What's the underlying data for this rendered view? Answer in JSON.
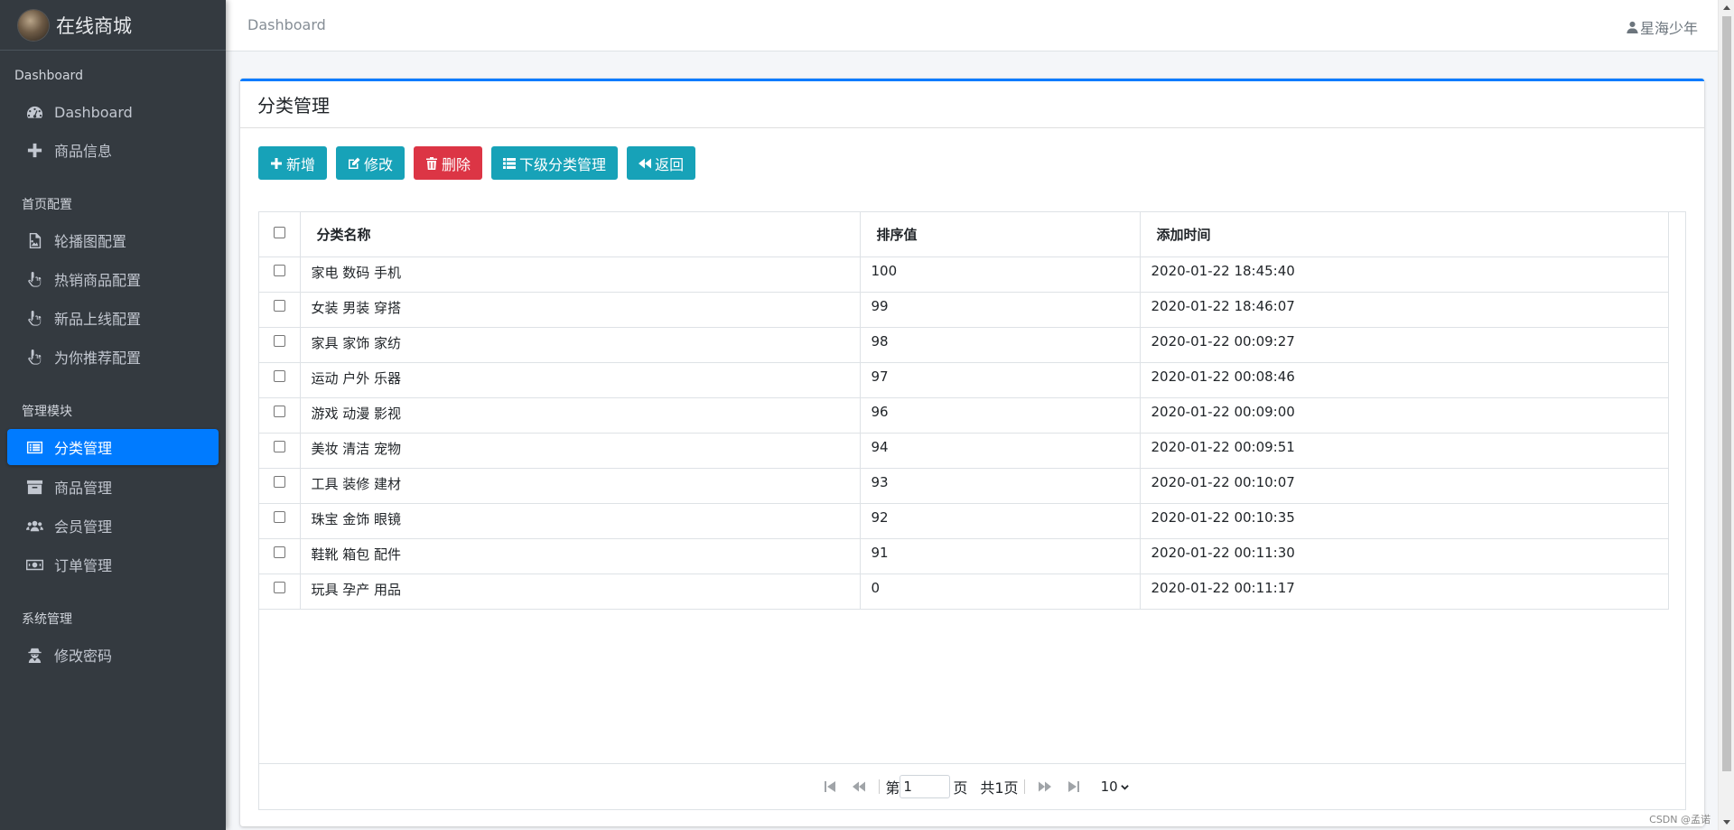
{
  "brand": {
    "name": "在线商城"
  },
  "sidebar": {
    "sections": [
      {
        "header": "Dashboard",
        "items": [
          {
            "label": "Dashboard",
            "icon": "tachometer-icon"
          },
          {
            "label": "商品信息",
            "icon": "plus-icon"
          }
        ]
      },
      {
        "header": "首页配置",
        "items": [
          {
            "label": "轮播图配置",
            "icon": "image-file-icon"
          },
          {
            "label": "热销商品配置",
            "icon": "hand-pointer-icon"
          },
          {
            "label": "新品上线配置",
            "icon": "hand-pointer-icon"
          },
          {
            "label": "为你推荐配置",
            "icon": "hand-pointer-icon"
          }
        ]
      },
      {
        "header": "管理模块",
        "items": [
          {
            "label": "分类管理",
            "icon": "list-alt-icon",
            "active": true
          },
          {
            "label": "商品管理",
            "icon": "archive-icon"
          },
          {
            "label": "会员管理",
            "icon": "users-icon"
          },
          {
            "label": "订单管理",
            "icon": "money-bill-icon"
          }
        ]
      },
      {
        "header": "系统管理",
        "items": [
          {
            "label": "修改密码",
            "icon": "user-secret-icon"
          }
        ]
      }
    ]
  },
  "topbar": {
    "breadcrumb": "Dashboard",
    "username": "星海少年"
  },
  "card": {
    "title": "分类管理"
  },
  "toolbar": {
    "add": "新增",
    "edit": "修改",
    "delete": "删除",
    "sub_manage": "下级分类管理",
    "back": "返回"
  },
  "table": {
    "headers": {
      "name": "分类名称",
      "rank": "排序值",
      "time": "添加时间"
    },
    "rows": [
      {
        "name": "家电 数码 手机",
        "rank": "100",
        "time": "2020-01-22 18:45:40"
      },
      {
        "name": "女装 男装 穿搭",
        "rank": "99",
        "time": "2020-01-22 18:46:07"
      },
      {
        "name": "家具 家饰 家纺",
        "rank": "98",
        "time": "2020-01-22 00:09:27"
      },
      {
        "name": "运动 户外 乐器",
        "rank": "97",
        "time": "2020-01-22 00:08:46"
      },
      {
        "name": "游戏 动漫 影视",
        "rank": "96",
        "time": "2020-01-22 00:09:00"
      },
      {
        "name": "美妆 清洁 宠物",
        "rank": "94",
        "time": "2020-01-22 00:09:51"
      },
      {
        "name": "工具 装修 建材",
        "rank": "93",
        "time": "2020-01-22 00:10:07"
      },
      {
        "name": "珠宝 金饰 眼镜",
        "rank": "92",
        "time": "2020-01-22 00:10:35"
      },
      {
        "name": "鞋靴 箱包 配件",
        "rank": "91",
        "time": "2020-01-22 00:11:30"
      },
      {
        "name": "玩具 孕产 用品",
        "rank": "0",
        "time": "2020-01-22 00:11:17"
      }
    ]
  },
  "pager": {
    "page_prefix": "第",
    "page_value": "1",
    "page_suffix": "页",
    "total": "共1页",
    "page_size": "10"
  },
  "watermark": "CSDN @孟诺",
  "colors": {
    "sidebar_bg": "#343a40",
    "active": "#007bff",
    "info": "#17a2b8",
    "danger": "#dc3545"
  }
}
